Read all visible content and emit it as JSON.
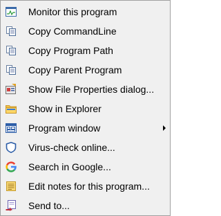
{
  "menu": {
    "items": [
      {
        "label": "Monitor this program",
        "icon": "monitor-icon"
      },
      {
        "label": "Copy CommandLine",
        "icon": "copy-icon"
      },
      {
        "label": "Copy Program Path",
        "icon": "copy-icon"
      },
      {
        "label": "Copy Parent Program",
        "icon": "copy-icon"
      },
      {
        "label": "Show File Properties dialog...",
        "icon": "file-properties-icon"
      },
      {
        "label": "Show in Explorer",
        "icon": "folder-icon"
      },
      {
        "label": "Program window",
        "icon": "window-icon",
        "has_submenu": true
      },
      {
        "label": "Virus-check online...",
        "icon": "shield-icon"
      },
      {
        "label": "Search in Google...",
        "icon": "google-icon"
      },
      {
        "label": "Edit notes for this program...",
        "icon": "notes-icon"
      },
      {
        "label": "Send to...",
        "icon": "send-to-icon"
      }
    ]
  }
}
